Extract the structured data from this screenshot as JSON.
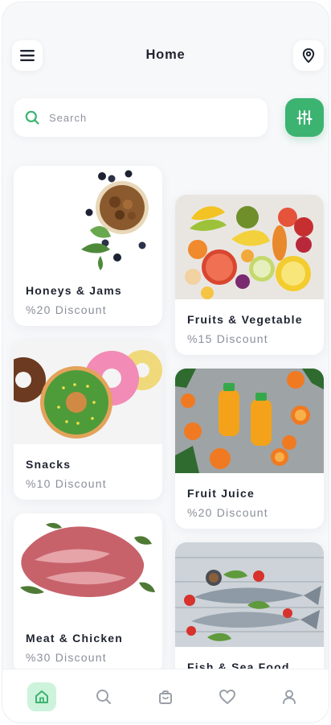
{
  "header": {
    "title": "Home"
  },
  "search": {
    "placeholder": "Search"
  },
  "categories": [
    {
      "name": "Honeys & Jams",
      "discount": "%20 Discount"
    },
    {
      "name": "Fruits & Vegetable",
      "discount": "%15 Discount"
    },
    {
      "name": "Snacks",
      "discount": "%10 Discount"
    },
    {
      "name": "Fruit Juice",
      "discount": "%20 Discount"
    },
    {
      "name": "Meat & Chicken",
      "discount": "%30 Discount"
    },
    {
      "name": "Fish & Sea Food",
      "discount": ""
    }
  ],
  "bottom_nav": {
    "items": [
      "home-icon",
      "search-icon",
      "shopping-bag-icon",
      "heart-icon",
      "profile-icon"
    ],
    "active": "home"
  },
  "colors": {
    "accent": "#3cb371",
    "active_tab_bg": "#cdf3dc",
    "text_primary": "#1f2430",
    "text_secondary": "#8a8f99"
  }
}
